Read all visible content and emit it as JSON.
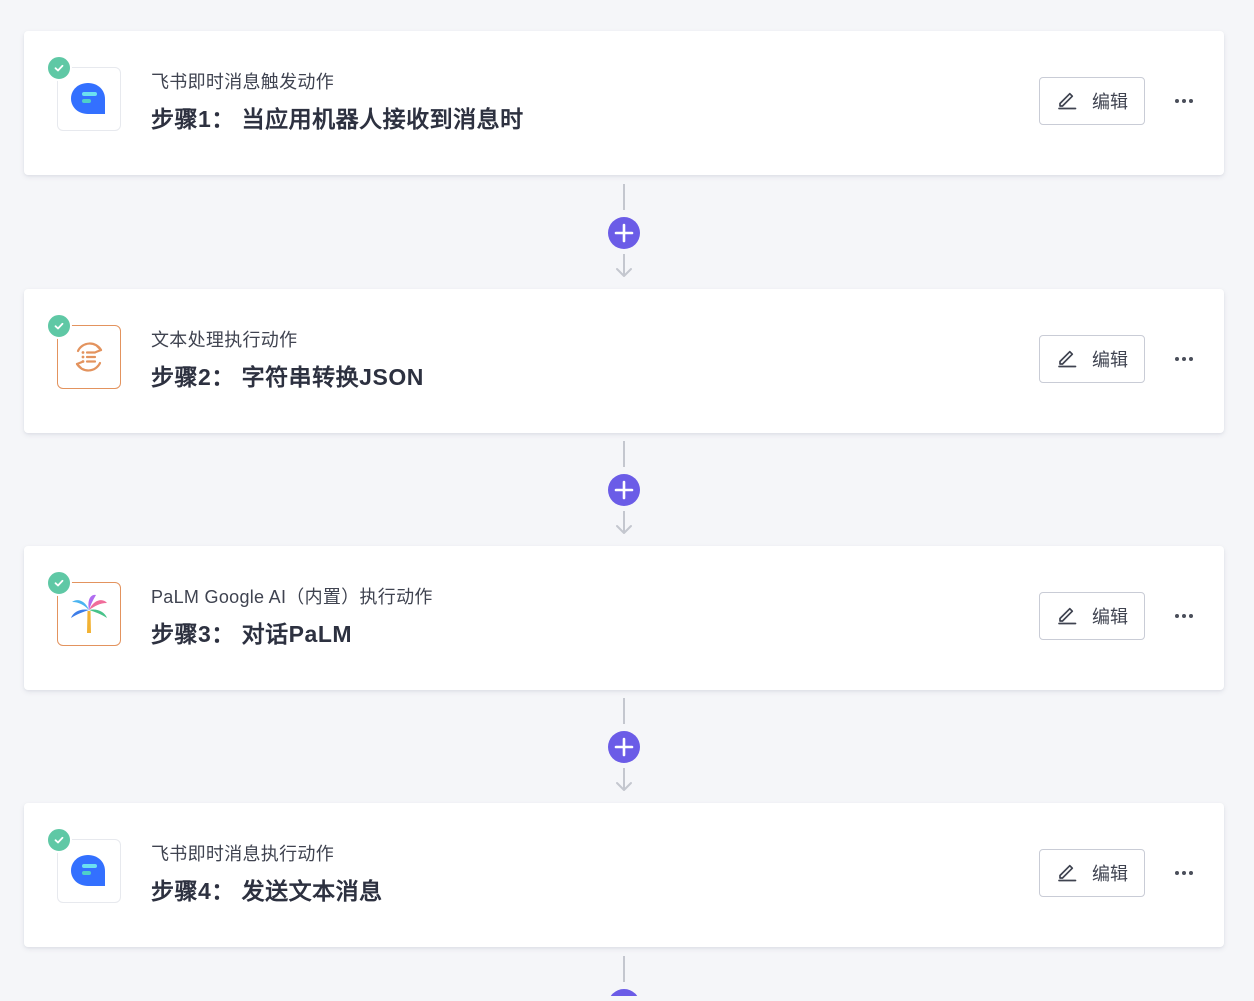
{
  "colors": {
    "accent": "#6b5ce7",
    "success": "#5fc8a5",
    "feishu_blue": "#3370ff",
    "text_orange": "#e3935e"
  },
  "steps": [
    {
      "subtitle": "飞书即时消息触发动作",
      "title": "步骤1： 当应用机器人接收到消息时",
      "icon": "feishu-message-icon",
      "status": "completed",
      "edit_label": "编辑"
    },
    {
      "subtitle": "文本处理执行动作",
      "title": "步骤2： 字符串转换JSON",
      "icon": "text-processing-icon",
      "status": "completed",
      "edit_label": "编辑"
    },
    {
      "subtitle": "PaLM Google AI（内置）执行动作",
      "title": "步骤3： 对话PaLM",
      "icon": "palm-tree-icon",
      "status": "completed",
      "edit_label": "编辑"
    },
    {
      "subtitle": "飞书即时消息执行动作",
      "title": "步骤4： 发送文本消息",
      "icon": "feishu-message-icon",
      "status": "completed",
      "edit_label": "编辑"
    }
  ],
  "icons": {
    "edit": "pencil-icon",
    "more": "ellipsis-icon",
    "add": "plus-circle-icon",
    "status": "check-icon"
  }
}
